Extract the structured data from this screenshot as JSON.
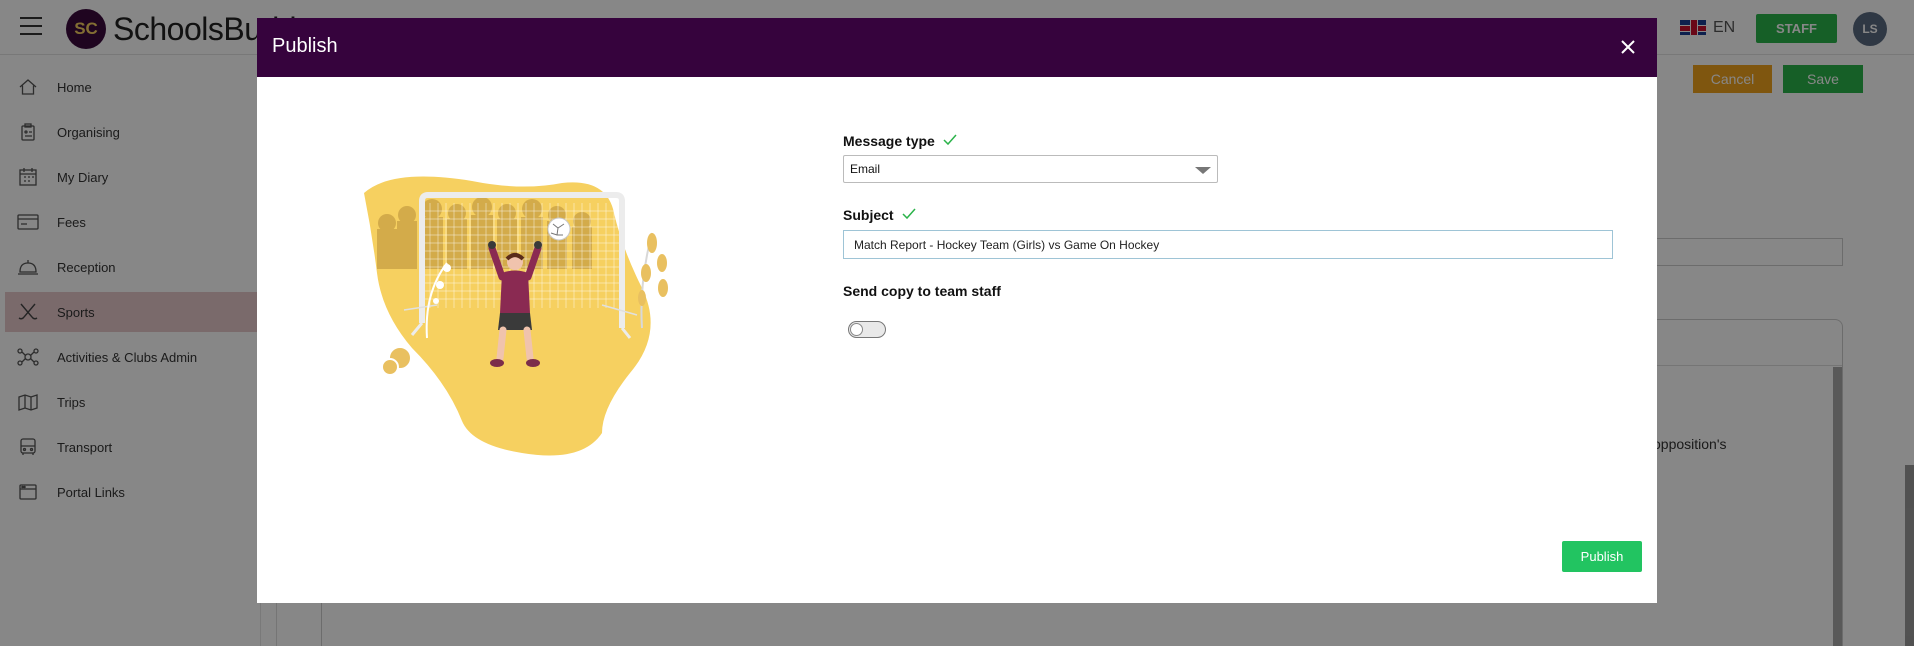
{
  "app": {
    "brand_name": "SchoolsBuddy",
    "logo_text": "SC",
    "language": "EN",
    "staff_label": "STAFF",
    "user_initials": "LS"
  },
  "sidebar": {
    "items": [
      {
        "label": "Home",
        "icon": "home-icon",
        "active": false
      },
      {
        "label": "Organising",
        "icon": "clipboard-icon",
        "active": false
      },
      {
        "label": "My Diary",
        "icon": "calendar-icon",
        "active": false
      },
      {
        "label": "Fees",
        "icon": "card-icon",
        "active": false
      },
      {
        "label": "Reception",
        "icon": "bell-icon",
        "active": false
      },
      {
        "label": "Sports",
        "icon": "hockey-sticks-icon",
        "active": true
      },
      {
        "label": "Activities & Clubs Admin",
        "icon": "network-icon",
        "active": false
      },
      {
        "label": "Trips",
        "icon": "map-icon",
        "active": false
      },
      {
        "label": "Transport",
        "icon": "bus-icon",
        "active": false
      },
      {
        "label": "Portal Links",
        "icon": "browser-icon",
        "active": false
      }
    ]
  },
  "page_actions": {
    "cancel_label": "Cancel",
    "save_label": "Save"
  },
  "background_text": "opposition's",
  "modal": {
    "title": "Publish",
    "message_type": {
      "label": "Message type",
      "value": "Email"
    },
    "subject": {
      "label": "Subject",
      "value": "Match Report - Hockey Team (Girls) vs Game On Hockey"
    },
    "send_copy": {
      "label": "Send copy to team staff",
      "enabled": false
    },
    "publish_label": "Publish"
  },
  "colors": {
    "header_purple": "#36033d",
    "publish_green": "#22c461",
    "check_green": "#2bb34a",
    "cancel_orange": "#f0a21e",
    "sports_active": "#e6c8cb",
    "illustration_yellow": "#f6d060"
  }
}
